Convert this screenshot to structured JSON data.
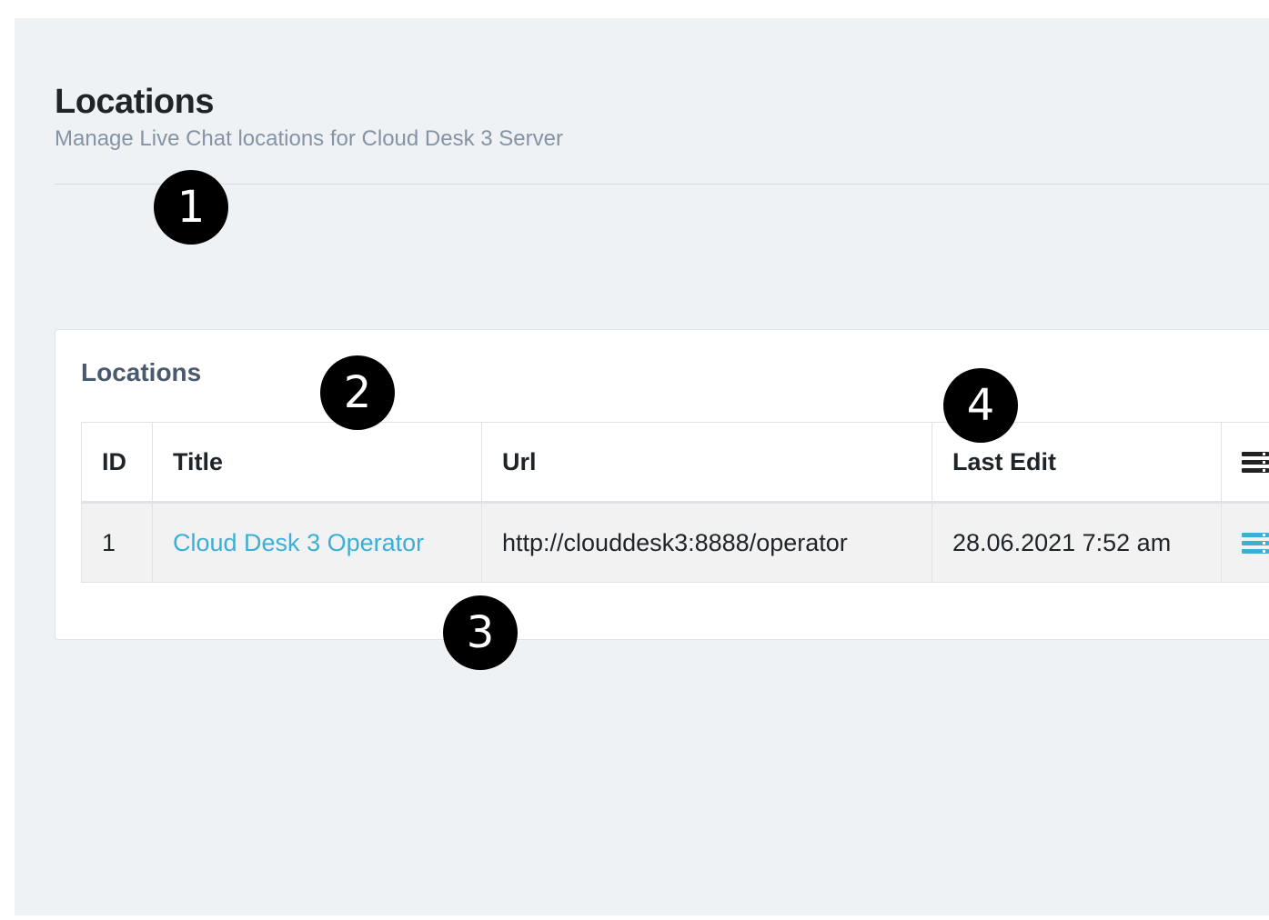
{
  "header": {
    "title": "Locations",
    "subtitle": "Manage Live Chat locations for Cloud Desk 3 Server"
  },
  "card": {
    "title": "Locations"
  },
  "table": {
    "columns": {
      "id": "ID",
      "title": "Title",
      "url": "Url",
      "last_edit": "Last Edit",
      "actions_icon": "list-icon"
    },
    "rows": [
      {
        "id": "1",
        "title": "Cloud Desk 3 Operator",
        "url": "http://clouddesk3:8888/operator",
        "last_edit": "28.06.2021 7:52 am",
        "action_icon": "list-icon"
      }
    ]
  },
  "markers": [
    "1",
    "2",
    "3",
    "4"
  ],
  "colors": {
    "background": "#eff2f5",
    "link": "#3bafd6",
    "subtitle": "#8593a3"
  }
}
